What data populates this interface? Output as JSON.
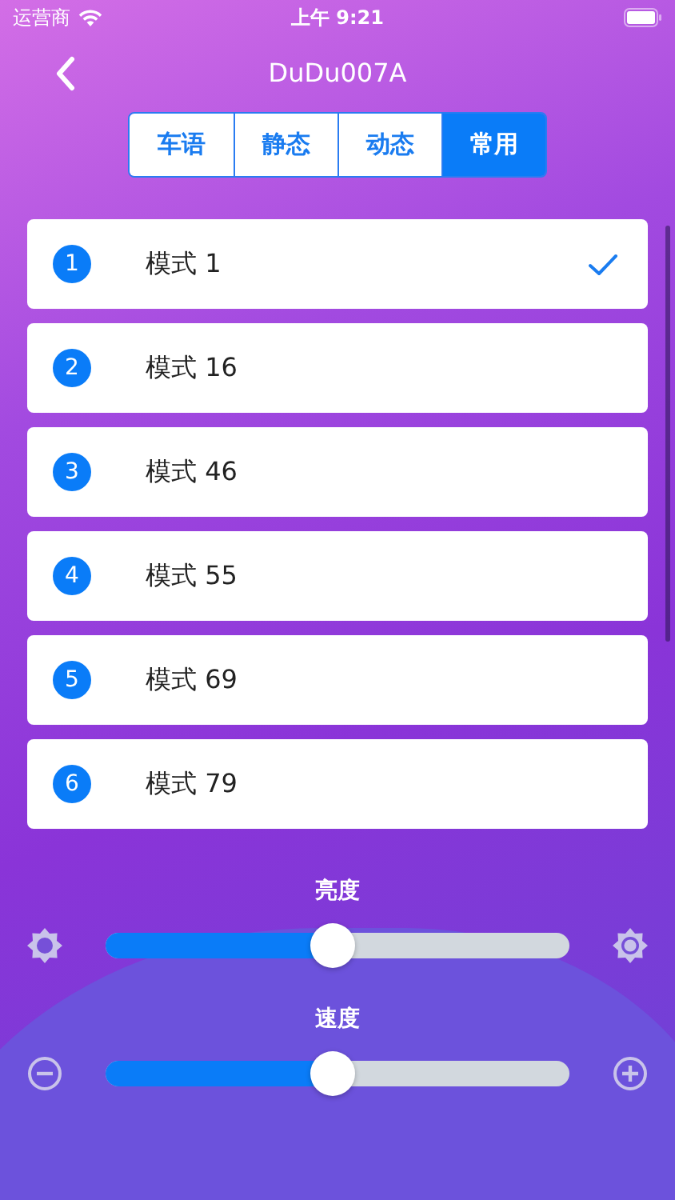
{
  "status_bar": {
    "carrier": "运营商",
    "time": "上午 9:21"
  },
  "nav": {
    "title": "DuDu007A"
  },
  "tabs": [
    {
      "label": "车语",
      "selected": false
    },
    {
      "label": "静态",
      "selected": false
    },
    {
      "label": "动态",
      "selected": false
    },
    {
      "label": "常用",
      "selected": true
    }
  ],
  "modes": [
    {
      "number": "1",
      "name": "模式 1",
      "selected": true
    },
    {
      "number": "2",
      "name": "模式 16",
      "selected": false
    },
    {
      "number": "3",
      "name": "模式 46",
      "selected": false
    },
    {
      "number": "4",
      "name": "模式 55",
      "selected": false
    },
    {
      "number": "5",
      "name": "模式 69",
      "selected": false
    },
    {
      "number": "6",
      "name": "模式 79",
      "selected": false
    }
  ],
  "sliders": [
    {
      "kind": "brightness",
      "label": "亮度",
      "level": 0.49
    },
    {
      "kind": "speed",
      "label": "速度",
      "level": 0.49
    }
  ]
}
